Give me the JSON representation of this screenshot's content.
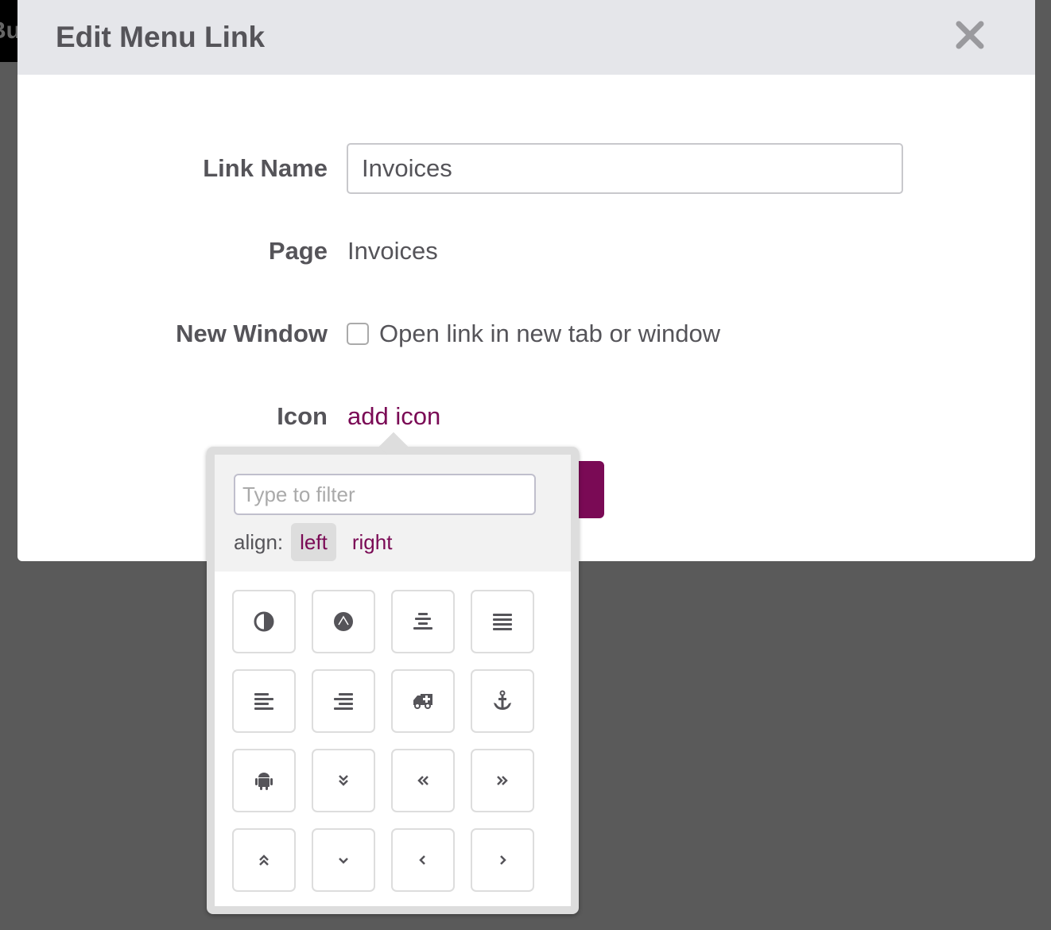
{
  "background": {
    "partial_text": "Bu"
  },
  "modal": {
    "title": "Edit Menu Link",
    "close_icon": "close-icon",
    "fields": {
      "link_name_label": "Link Name",
      "link_name_value": "Invoices",
      "page_label": "Page",
      "page_value": "Invoices",
      "new_window_label": "New Window",
      "new_window_checked": false,
      "new_window_text": "Open link in new tab or window",
      "icon_label": "Icon",
      "icon_link": "add icon"
    }
  },
  "icon_picker": {
    "filter_placeholder": "Type to filter",
    "align_label": "align:",
    "align_options": [
      "left",
      "right"
    ],
    "align_selected": "left",
    "icons": [
      "adjust",
      "adn",
      "align-center",
      "align-justify",
      "align-left",
      "align-right",
      "ambulance",
      "anchor",
      "android",
      "angle-double-down",
      "angle-double-left",
      "angle-double-right",
      "angle-double-up",
      "angle-down",
      "angle-left",
      "angle-right"
    ]
  },
  "colors": {
    "accent": "#7a0a55",
    "header_bg": "#e5e6ea",
    "overlay": "#5a5a5a"
  }
}
